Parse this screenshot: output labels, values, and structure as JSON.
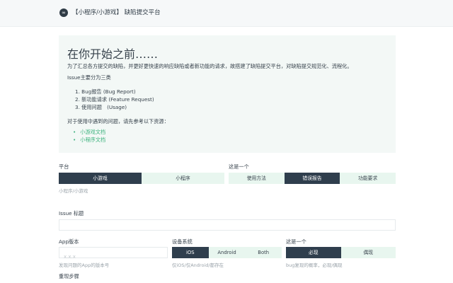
{
  "header": {
    "logo_glyph": "∞",
    "title": "【小程序/小游戏】 缺陷提交平台"
  },
  "intro": {
    "title": "在你开始之前……",
    "description": "为了汇总各方提交的缺陷，并更好更快速的响应缺陷或者新功能的请求，故搭建了缺陷提交平台，对缺陷提交规范化、流程化。",
    "subtitle": "Issue主要分为三类",
    "types": [
      "Bug报告 (Bug Report)",
      "新功能请求 (Feature Request)",
      "使用问题　(Usage)"
    ],
    "reference": "对于使用中遇到的问题，请先参考以下资源：",
    "links": [
      "小游戏文档",
      "小程序文档"
    ]
  },
  "platform": {
    "label": "平台",
    "options": [
      "小游戏",
      "小程序"
    ],
    "selected": "小游戏",
    "hint": "小程序/小游戏"
  },
  "type": {
    "label": "这是一个",
    "options": [
      "使用方法",
      "错误报告",
      "功能要求"
    ],
    "selected": "错误报告"
  },
  "issue_title": {
    "label": "Issue 标题",
    "value": "",
    "placeholder": ""
  },
  "app_version": {
    "label": "App版本",
    "placeholder": "x.x.x",
    "value": "",
    "hint": "发现问题的App的版本号"
  },
  "device_os": {
    "label": "设备系统",
    "options": [
      "iOS",
      "Android",
      "Both"
    ],
    "selected": "iOS",
    "hint": "仅iOS/仅Android/都存在"
  },
  "frequency": {
    "label": "这是一个",
    "options": [
      "必现",
      "偶现"
    ],
    "selected": "必现",
    "hint": "bug复现的概率，必现/偶现"
  },
  "repro_steps": {
    "label": "重现步骤"
  },
  "colors": {
    "accent": "#2f3e4d",
    "option_bg": "#e8f6ef",
    "intro_bg": "#f3f8f6",
    "link": "#3fb37f"
  }
}
